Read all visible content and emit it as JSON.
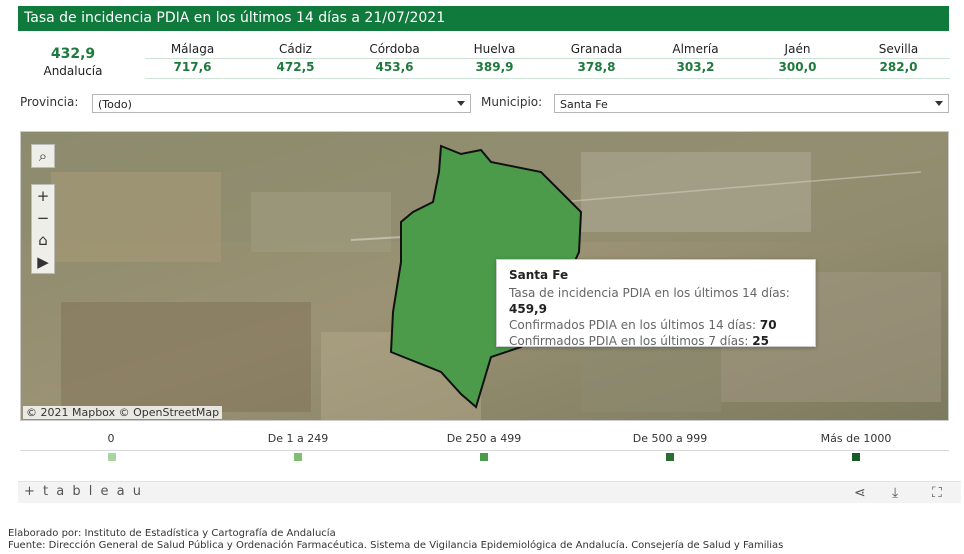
{
  "header": {
    "title": "Tasa de incidencia PDIA en los últimos 14 días a 21/07/2021"
  },
  "summary": {
    "total_value": "432,9",
    "total_label": "Andalucía"
  },
  "provinces": [
    {
      "name": "Málaga",
      "value": "717,6"
    },
    {
      "name": "Cádiz",
      "value": "472,5"
    },
    {
      "name": "Córdoba",
      "value": "453,6"
    },
    {
      "name": "Huelva",
      "value": "389,9"
    },
    {
      "name": "Granada",
      "value": "378,8"
    },
    {
      "name": "Almería",
      "value": "303,2"
    },
    {
      "name": "Jaén",
      "value": "300,0"
    },
    {
      "name": "Sevilla",
      "value": "282,0"
    }
  ],
  "filters": {
    "provincia_label": "Provincia:",
    "provincia_value": "(Todo)",
    "municipio_label": "Municipio:",
    "municipio_value": "Santa Fe"
  },
  "map": {
    "attribution": "© 2021 Mapbox  © OpenStreetMap",
    "controls": [
      "search-icon",
      "zoom-in-icon",
      "zoom-out-icon",
      "home-icon",
      "play-icon"
    ],
    "region_color": "#4b9b4b"
  },
  "tooltip": {
    "title": "Santa Fe",
    "line1_label": "Tasa de incidencia PDIA en los últimos 14 días:",
    "line1_value": "459,9",
    "line2_label": "Confirmados PDIA en los últimos 14 días:",
    "line2_value": "70",
    "line3_label": "Confirmados PDIA en los últimos 7 días:",
    "line3_value": "25"
  },
  "legend": {
    "items": [
      {
        "label": "0",
        "color": "#a8d5a0"
      },
      {
        "label": "De 1 a 249",
        "color": "#7cc070"
      },
      {
        "label": "De 250 a 499",
        "color": "#4b9b4b"
      },
      {
        "label": "De 500 a 999",
        "color": "#2a6e32"
      },
      {
        "label": "Más de 1000",
        "color": "#1a5a25"
      }
    ]
  },
  "toolbar": {
    "brand": "+ t a b l e a u"
  },
  "notes": {
    "line1": "Elaborado por: Instituto de Estadística y Cartografía de Andalucía",
    "line2": "Fuente: Dirección General de Salud Pública y Ordenación Farmacéutica. Sistema de Vigilancia Epidemiológica de Andalucía. Consejería de Salud y Familias"
  }
}
